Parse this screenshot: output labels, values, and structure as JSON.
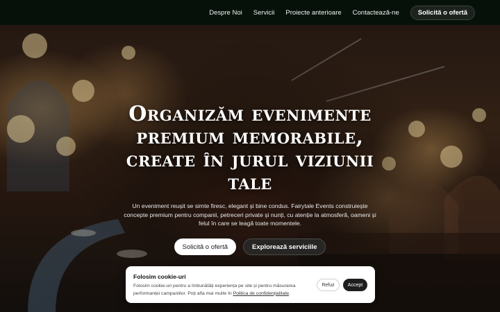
{
  "nav": {
    "links": [
      "Despre Noi",
      "Servicii",
      "Proiecte anterioare",
      "Contactează-ne"
    ],
    "cta": "Solicită o ofertă"
  },
  "hero": {
    "title": "Organizăm evenimente premium memorabile, create în jurul viziunii tale",
    "subtitle": "Un eveniment reușit se simte firesc, elegant și bine condus. Fairytale Events construiește concepte premium pentru companii, petreceri private și nunți, cu atenție la atmosferă, oameni și felul în care se leagă toate momentele.",
    "primary_button": "Solicită o ofertă",
    "secondary_button": "Explorează serviciile"
  },
  "cookie": {
    "title": "Folosim cookie-uri",
    "text": "Folosim cookie-uri pentru a îmbunătăți experiența pe site și pentru măsurarea performanței campaniilor. Poți afla mai multe în",
    "link": "Politica de confidențialitate",
    "text_end": ".",
    "refuse": "Refuz",
    "accept": "Accept"
  },
  "colors": {
    "header_bg": "#06110a",
    "cookie_accept_bg": "#1e1e1e"
  }
}
